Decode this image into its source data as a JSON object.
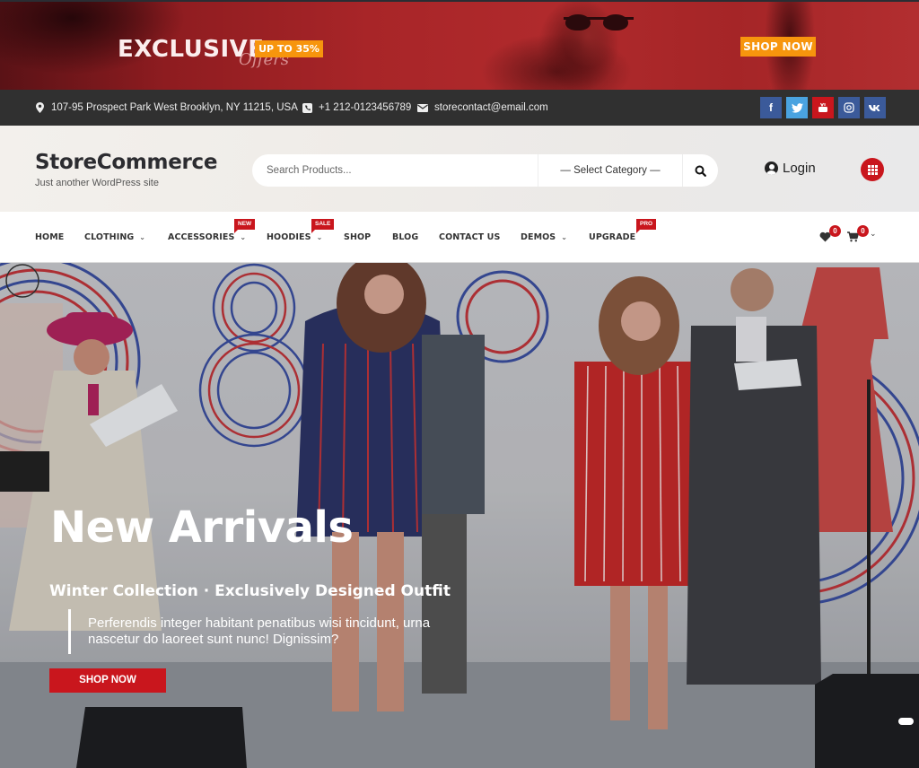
{
  "promo": {
    "headline": "EXCLUSIVE",
    "script_text": "Offers",
    "badge": "UP TO 35%",
    "cta": "SHOP NOW",
    "accent_color": "#f7950d"
  },
  "infobar": {
    "address": "107-95 Prospect Park West Brooklyn, NY 11215, USA",
    "phone": "+1 212-0123456789",
    "email": "storecontact@email.com",
    "social": [
      {
        "name": "facebook",
        "glyph": "f",
        "color": "#3b5a9a"
      },
      {
        "name": "twitter",
        "glyph": "t",
        "color": "#4aa3e0"
      },
      {
        "name": "youtube",
        "glyph": "▶",
        "color": "#c9161d"
      },
      {
        "name": "instagram",
        "glyph": "◎",
        "color": "#3b5a9a"
      },
      {
        "name": "vk",
        "glyph": "vk",
        "color": "#3b5a9a"
      }
    ]
  },
  "header": {
    "site_title": "StoreCommerce",
    "tagline": "Just another WordPress site",
    "search_placeholder": "Search Products...",
    "category_select": "— Select Category —",
    "login_label": "Login"
  },
  "nav": {
    "items": [
      {
        "label": "HOME",
        "chevron": false
      },
      {
        "label": "CLOTHING",
        "chevron": true
      },
      {
        "label": "ACCESSORIES",
        "chevron": true,
        "badge": "NEW"
      },
      {
        "label": "HOODIES",
        "chevron": true,
        "badge": "SALE"
      },
      {
        "label": "SHOP",
        "chevron": false
      },
      {
        "label": "BLOG",
        "chevron": false
      },
      {
        "label": "CONTACT US",
        "chevron": false
      },
      {
        "label": "DEMOS",
        "chevron": true
      },
      {
        "label": "UPGRADE",
        "chevron": false,
        "badge": "PRO"
      }
    ],
    "wishlist_count": "0",
    "cart_count": "0"
  },
  "hero": {
    "title": "New Arrivals",
    "subtitle": "Winter Collection · Exclusively Designed Outfit",
    "text": "Perferendis integer habitant penatibus wisi tincidunt, urna nascetur do laoreet sunt nunc! Dignissim?",
    "cta": "SHOP NOW"
  },
  "colors": {
    "brand_red": "#c9161d",
    "infobar_bg": "#303030",
    "promo_orange": "#f7950d"
  }
}
